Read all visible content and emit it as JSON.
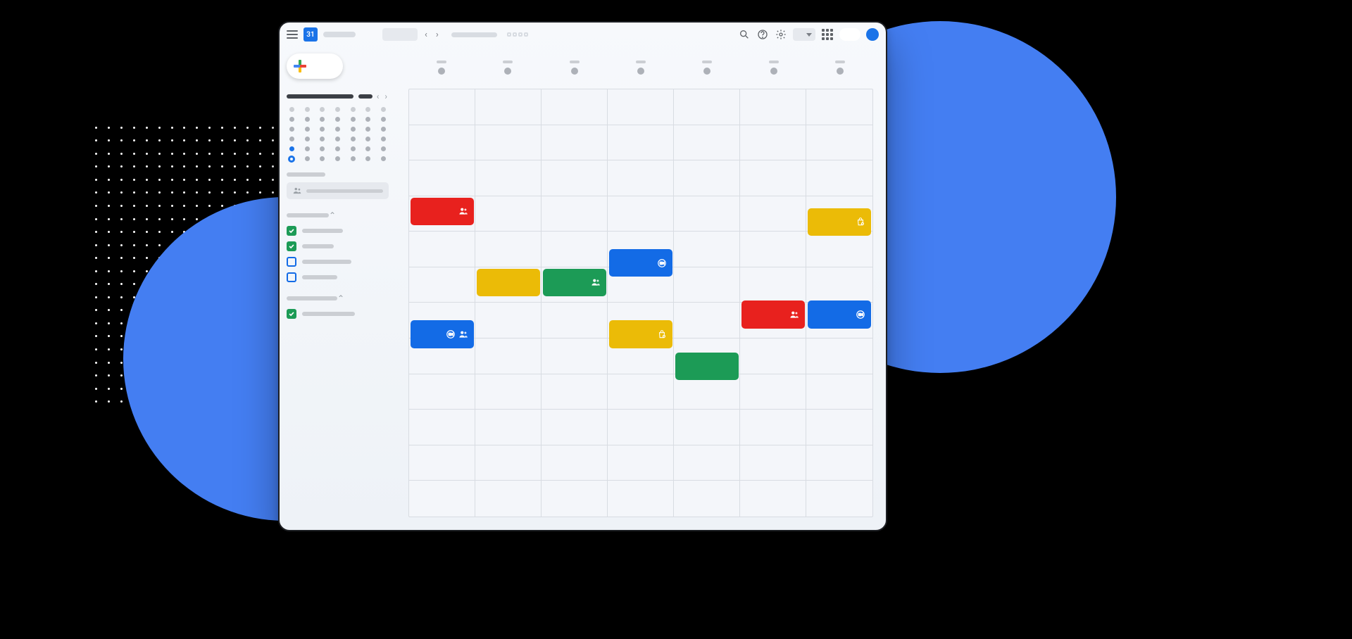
{
  "decor": {
    "dots_cols": 15,
    "dots_rows": 22
  },
  "topbar": {
    "logo_date": "31",
    "nav_prev": "‹",
    "nav_next": "›"
  },
  "sidebar": {
    "minical": {
      "rows": 6,
      "cols": 7,
      "selected_index": 28,
      "ring_index": 35
    },
    "calendars": [
      {
        "color": "#1c9b56",
        "checked": true,
        "label_width": 58
      },
      {
        "color": "#1c9b56",
        "checked": true,
        "label_width": 45
      },
      {
        "color": "#136be6",
        "checked": false,
        "label_width": 70
      },
      {
        "color": "#136be6",
        "checked": false,
        "label_width": 50
      }
    ],
    "other_cals": [
      {
        "color": "#1c9b56",
        "checked": true,
        "label_width": 75
      }
    ]
  },
  "grid": {
    "days": 7,
    "rows": 12,
    "col_w_pct": 14.2857,
    "row_h_pct": 8.3333
  },
  "events": [
    {
      "color": "red",
      "col": 0,
      "row": 3,
      "span": 1,
      "icons": [
        "people"
      ]
    },
    {
      "color": "yellow",
      "col": 6,
      "row": 3,
      "span": 1,
      "icons": [
        "bag"
      ],
      "row_offset": 0.3
    },
    {
      "color": "blue",
      "col": 3,
      "row": 4,
      "span": 1,
      "icons": [
        "video"
      ],
      "row_offset": 0.45
    },
    {
      "color": "yellow",
      "col": 1,
      "row": 5,
      "span": 1,
      "icons": []
    },
    {
      "color": "green",
      "col": 2,
      "row": 5,
      "span": 1,
      "icons": [
        "people"
      ]
    },
    {
      "color": "red",
      "col": 5,
      "row": 6,
      "span": 1,
      "icons": [
        "people"
      ],
      "row_offset": -0.1
    },
    {
      "color": "blue",
      "col": 6,
      "row": 6,
      "span": 1,
      "icons": [
        "video"
      ],
      "row_offset": -0.1
    },
    {
      "color": "blue",
      "col": 0,
      "row": 7,
      "span": 1,
      "icons": [
        "video",
        "people"
      ],
      "row_offset": -0.55
    },
    {
      "color": "yellow",
      "col": 3,
      "row": 7,
      "span": 1,
      "icons": [
        "bag"
      ],
      "row_offset": -0.55
    },
    {
      "color": "green",
      "col": 4,
      "row": 8,
      "span": 1,
      "icons": [],
      "row_offset": -0.65
    }
  ]
}
